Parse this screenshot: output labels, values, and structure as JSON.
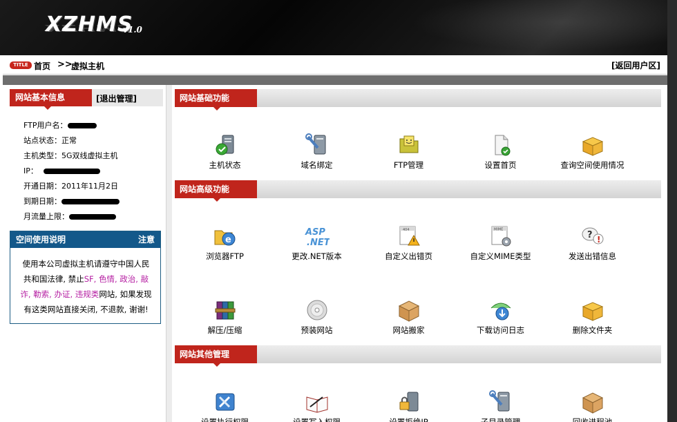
{
  "header": {
    "logo": "XZHMS",
    "version": "v1.0"
  },
  "breadcrumb": {
    "badge": "TITLE",
    "home": "首页",
    "sep": ">>",
    "current": "虚拟主机",
    "back": "[返回用户区]"
  },
  "site_info": {
    "tab": "网站基本信息",
    "logout": "[退出管理]",
    "rows": [
      {
        "label": "FTP用户名：",
        "value": ""
      },
      {
        "label": "站点状态：",
        "value": "正常"
      },
      {
        "label": "主机类型：",
        "value": "5G双线虚拟主机"
      },
      {
        "label": "IP：",
        "value": ""
      },
      {
        "label": "开通日期：",
        "value": "2011年11月2日"
      },
      {
        "label": "到期日期：",
        "value": ""
      },
      {
        "label": "月流量上限：",
        "value": ""
      }
    ]
  },
  "notice": {
    "title": "空间使用说明",
    "tag": "注意",
    "line1": "使用本公司虚拟主机请遵守中国人民",
    "line2a": "共和国法律, 禁止",
    "line2b": "SF, 色情, 政治, 敲",
    "line3a": "诈, 勒索, 办证, 违规类",
    "line3b": "网站, 如果发现",
    "line4": "有这类网站直接关闭, 不退款, 谢谢!"
  },
  "sections": {
    "basic": {
      "title": "网站基础功能",
      "items": [
        "主机状态",
        "域名绑定",
        "FTP管理",
        "设置首页",
        "查询空间使用情况"
      ]
    },
    "advanced": {
      "title": "网站高级功能",
      "items": [
        "浏览器FTP",
        "更改.NET版本",
        "自定义出错页",
        "自定义MIME类型",
        "发送出错信息",
        "解压/压缩",
        "预装网站",
        "网站搬家",
        "下载访问日志",
        "删除文件夹"
      ]
    },
    "other": {
      "title": "网站其他管理",
      "items": [
        "设置执行权限",
        "设置写入权限",
        "设置拒绝IP",
        "子目录管理",
        "回收进程池"
      ]
    }
  },
  "icons": {
    "asp_text_1": "ASP",
    "asp_text_2": ".NET",
    "page404": "404",
    "mime": "MIME"
  }
}
